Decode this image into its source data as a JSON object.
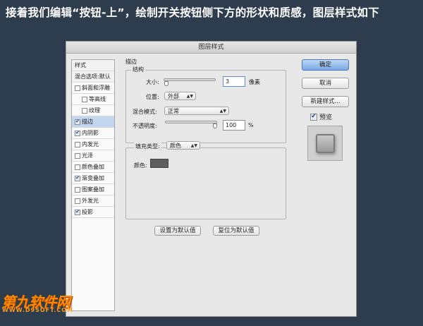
{
  "caption": "接着我们编辑“按钮-上”，绘制开关按钮侧下方的形状和质感，图层样式如下",
  "dialog": {
    "title": "图层样式",
    "left_panel": {
      "items": [
        {
          "label": "样式",
          "type": "header"
        },
        {
          "label": "混合选项:默认",
          "type": "header"
        },
        {
          "label": "斜面和浮雕",
          "checked": false
        },
        {
          "label": "等高线",
          "checked": false,
          "indent": true
        },
        {
          "label": "纹理",
          "checked": false,
          "indent": true
        },
        {
          "label": "描边",
          "checked": true,
          "selected": true
        },
        {
          "label": "内阴影",
          "checked": true
        },
        {
          "label": "内发光",
          "checked": false
        },
        {
          "label": "光泽",
          "checked": false
        },
        {
          "label": "颜色叠加",
          "checked": false
        },
        {
          "label": "渐变叠加",
          "checked": true
        },
        {
          "label": "图案叠加",
          "checked": false
        },
        {
          "label": "外发光",
          "checked": false
        },
        {
          "label": "投影",
          "checked": true
        }
      ]
    },
    "stroke": {
      "section_title": "描边",
      "structure_title": "结构",
      "size_label": "大小:",
      "size_value": "3",
      "size_unit": "像素",
      "size_fraction": 0.02,
      "position_label": "位置:",
      "position_value": "外部",
      "blend_label": "混合模式:",
      "blend_value": "正常",
      "opacity_label": "不透明度:",
      "opacity_value": "100",
      "opacity_unit": "%",
      "opacity_fraction": 1.0,
      "fill_type_label": "填充类型:",
      "fill_type_value": "颜色",
      "color_label": "颜色:",
      "color_value": "#5e5e5e"
    },
    "bottom_buttons": {
      "set_default": "设置为默认值",
      "reset_default": "复位为默认值"
    },
    "right": {
      "ok": "确定",
      "cancel": "取消",
      "new_style": "新建样式...",
      "preview_label": "预览",
      "preview_checked": true
    }
  },
  "watermark": {
    "main": "第九软件网",
    "sub": "WWW.D9SOFT.COM"
  }
}
